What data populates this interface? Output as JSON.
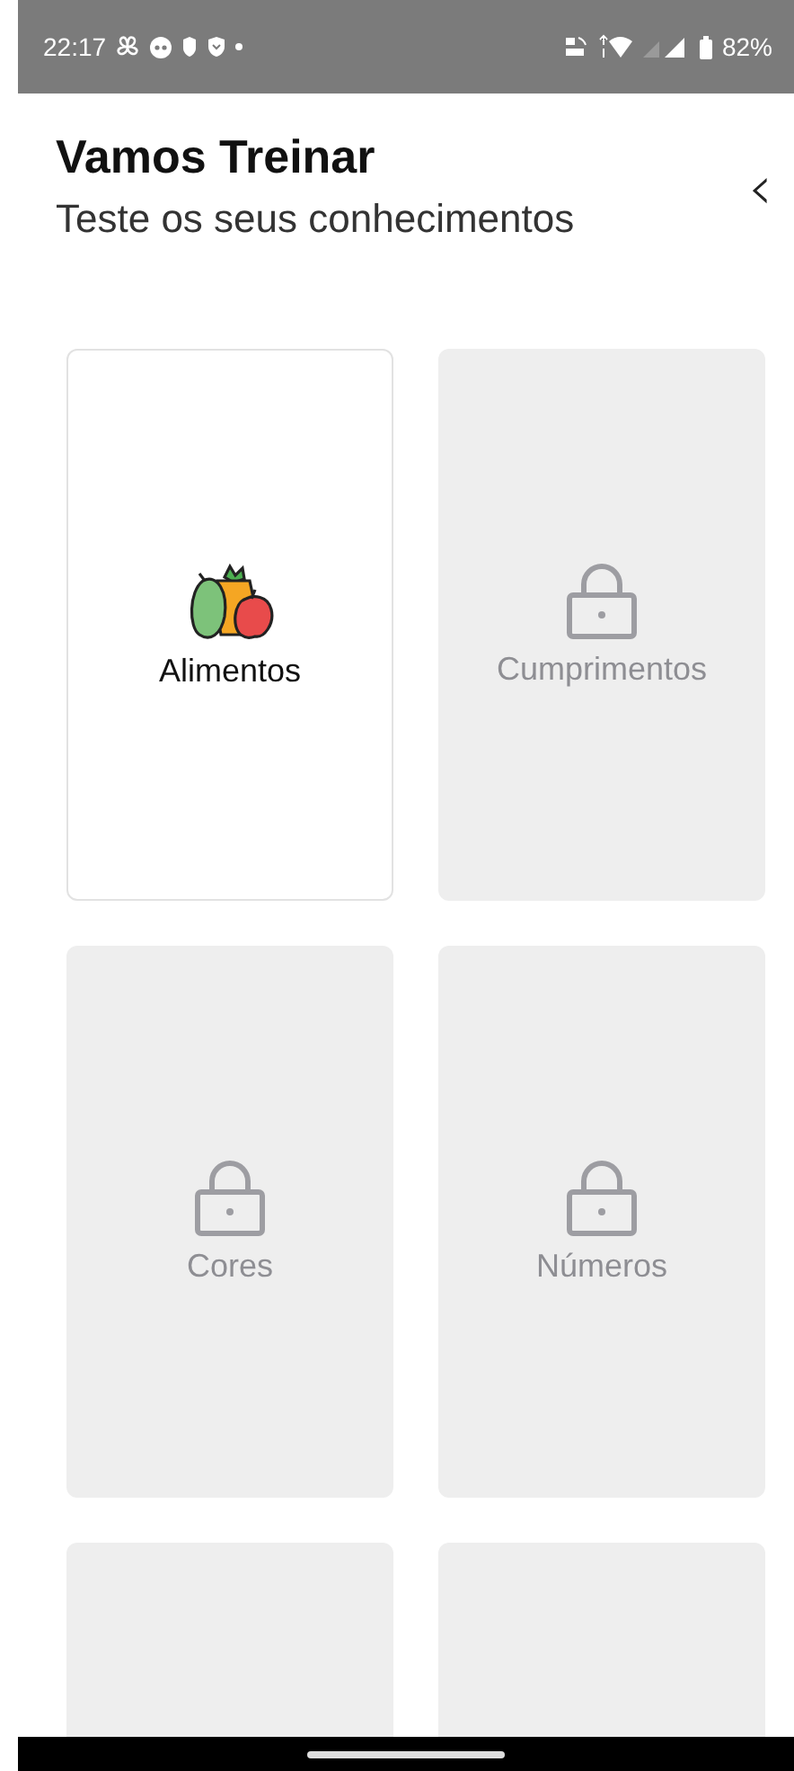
{
  "status_bar": {
    "time": "22:17",
    "battery": "82%"
  },
  "header": {
    "title": "Vamos Treinar",
    "subtitle": "Teste os seus conhecimentos",
    "back": "‹"
  },
  "topics": [
    {
      "label": "Alimentos",
      "locked": false
    },
    {
      "label": "Cumprimentos",
      "locked": true
    },
    {
      "label": "Cores",
      "locked": true
    },
    {
      "label": "Números",
      "locked": true
    },
    {
      "locked": true
    },
    {
      "locked": true
    }
  ]
}
